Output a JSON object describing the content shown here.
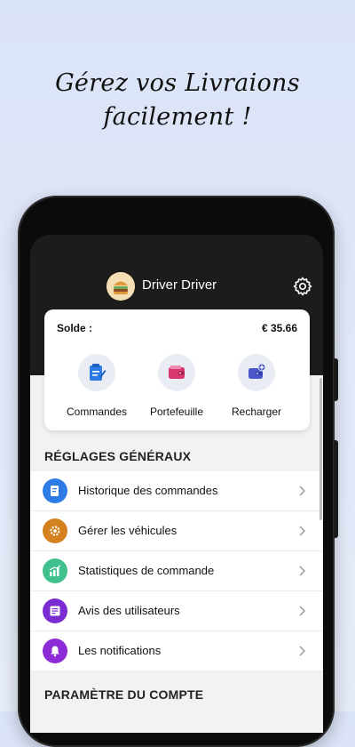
{
  "headline": {
    "line1": "Gérez vos Livraions",
    "line2": "facilement !"
  },
  "profile": {
    "name": "Driver Driver",
    "avatar_icon": "burger-avatar-icon",
    "settings_icon": "gear-icon"
  },
  "balance_card": {
    "label": "Solde :",
    "value": "€ 35.66",
    "actions": [
      {
        "label": "Commandes",
        "icon": "orders-icon",
        "color": "#2f7be5"
      },
      {
        "label": "Portefeuille",
        "icon": "wallet-icon",
        "color": "#d8366e"
      },
      {
        "label": "Recharger",
        "icon": "recharge-icon",
        "color": "#4b57c9"
      }
    ]
  },
  "general_settings": {
    "title": "RÉGLAGES GÉNÉRAUX",
    "items": [
      {
        "label": "Historique des commandes",
        "icon": "history-icon",
        "color": "#2f7be5"
      },
      {
        "label": "Gérer les véhicules",
        "icon": "vehicle-settings-icon",
        "color": "#d4821f"
      },
      {
        "label": "Statistiques de commande",
        "icon": "stats-icon",
        "color": "#3fc08c"
      },
      {
        "label": "Avis des utilisateurs",
        "icon": "reviews-icon",
        "color": "#7a2bd1"
      },
      {
        "label": "Les notifications",
        "icon": "bell-icon",
        "color": "#8d2bd6"
      }
    ]
  },
  "account_settings": {
    "title": "PARAMÈTRE DU COMPTE"
  }
}
